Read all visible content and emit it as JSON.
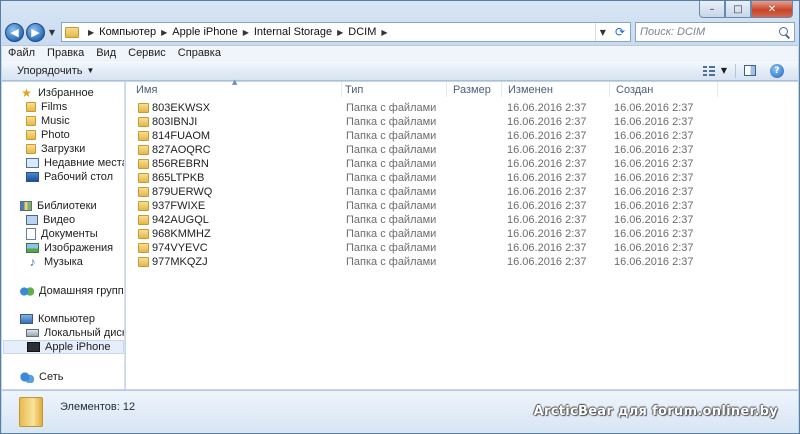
{
  "window": {
    "controls": [
      "–",
      "□",
      "✕"
    ]
  },
  "address": {
    "path": [
      "Компьютер",
      "Apple iPhone",
      "Internal Storage",
      "DCIM"
    ],
    "search_placeholder": "Поиск: DCIM"
  },
  "menubar": {
    "items": [
      "Файл",
      "Правка",
      "Вид",
      "Сервис",
      "Справка"
    ]
  },
  "commandbar": {
    "organize_label": "Упорядочить",
    "help_glyph": "?"
  },
  "navpane": {
    "favorites": {
      "label": "Избранное",
      "icon": "star-icon",
      "items": [
        {
          "label": "Films",
          "icon": "folder-icon"
        },
        {
          "label": "Music",
          "icon": "folder-icon"
        },
        {
          "label": "Photo",
          "icon": "folder-icon"
        },
        {
          "label": "Загрузки",
          "icon": "folder-icon"
        },
        {
          "label": "Недавние места",
          "icon": "recent-places-icon"
        },
        {
          "label": "Рабочий стол",
          "icon": "desktop-icon"
        }
      ]
    },
    "libraries": {
      "label": "Библиотеки",
      "icon": "libraries-icon",
      "items": [
        {
          "label": "Видео",
          "icon": "video-icon"
        },
        {
          "label": "Документы",
          "icon": "documents-icon"
        },
        {
          "label": "Изображения",
          "icon": "images-icon"
        },
        {
          "label": "Музыка",
          "icon": "music-icon"
        }
      ]
    },
    "homegroup": {
      "label": "Домашняя группа",
      "icon": "homegroup-icon"
    },
    "computer": {
      "label": "Компьютер",
      "icon": "computer-icon",
      "items": [
        {
          "label": "Локальный диск (C:)",
          "icon": "disk-icon"
        },
        {
          "label": "Apple iPhone",
          "icon": "iphone-icon",
          "selected": true
        }
      ]
    },
    "network": {
      "label": "Сеть",
      "icon": "network-icon"
    }
  },
  "filelist": {
    "columns": [
      "Имя",
      "Тип",
      "Размер",
      "Изменен",
      "Создан"
    ],
    "rows": [
      {
        "name": "803EKWSX",
        "type": "Папка с файлами",
        "size": "",
        "modified": "16.06.2016 2:37",
        "created": "16.06.2016 2:37"
      },
      {
        "name": "803IBNJI",
        "type": "Папка с файлами",
        "size": "",
        "modified": "16.06.2016 2:37",
        "created": "16.06.2016 2:37"
      },
      {
        "name": "814FUAOM",
        "type": "Папка с файлами",
        "size": "",
        "modified": "16.06.2016 2:37",
        "created": "16.06.2016 2:37"
      },
      {
        "name": "827AOQRC",
        "type": "Папка с файлами",
        "size": "",
        "modified": "16.06.2016 2:37",
        "created": "16.06.2016 2:37"
      },
      {
        "name": "856REBRN",
        "type": "Папка с файлами",
        "size": "",
        "modified": "16.06.2016 2:37",
        "created": "16.06.2016 2:37"
      },
      {
        "name": "865LTPKB",
        "type": "Папка с файлами",
        "size": "",
        "modified": "16.06.2016 2:37",
        "created": "16.06.2016 2:37"
      },
      {
        "name": "879UERWQ",
        "type": "Папка с файлами",
        "size": "",
        "modified": "16.06.2016 2:37",
        "created": "16.06.2016 2:37"
      },
      {
        "name": "937FWIXE",
        "type": "Папка с файлами",
        "size": "",
        "modified": "16.06.2016 2:37",
        "created": "16.06.2016 2:37"
      },
      {
        "name": "942AUGQL",
        "type": "Папка с файлами",
        "size": "",
        "modified": "16.06.2016 2:37",
        "created": "16.06.2016 2:37"
      },
      {
        "name": "968KMMHZ",
        "type": "Папка с файлами",
        "size": "",
        "modified": "16.06.2016 2:37",
        "created": "16.06.2016 2:37"
      },
      {
        "name": "974VYEVC",
        "type": "Папка с файлами",
        "size": "",
        "modified": "16.06.2016 2:37",
        "created": "16.06.2016 2:37"
      },
      {
        "name": "977MKQZJ",
        "type": "Папка с файлами",
        "size": "",
        "modified": "16.06.2016 2:37",
        "created": "16.06.2016 2:37"
      }
    ]
  },
  "details": {
    "count_text": "Элементов: 12",
    "watermark": "ArcticBear для forum.onliner.by"
  }
}
